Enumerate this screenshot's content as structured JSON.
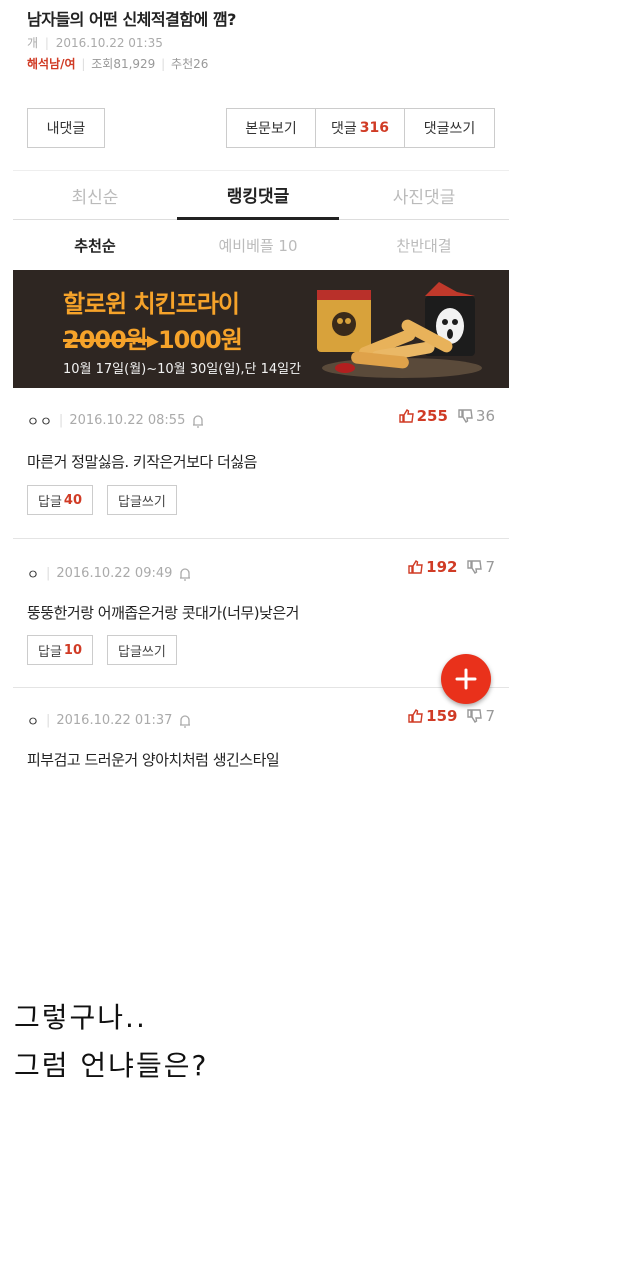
{
  "post": {
    "title": "남자들의 어떤 신체적결함에 깸?",
    "category": "개",
    "datetime": "2016.10.22 01:35",
    "author": "해석남/여",
    "views": "조회81,929",
    "recommends": "추천26"
  },
  "actions": {
    "my_comments": "내댓글",
    "view_post": "본문보기",
    "comments_label": "댓글",
    "comments_count": "316",
    "write_comment": "댓글쓰기"
  },
  "tabs": [
    {
      "label": "최신순"
    },
    {
      "label": "랭킹댓글"
    },
    {
      "label": "사진댓글"
    }
  ],
  "subtabs": [
    {
      "label": "추천순"
    },
    {
      "label": "예비베플 10"
    },
    {
      "label": "찬반대결"
    }
  ],
  "banner": {
    "title": "할로윈 치킨프라이",
    "old_price": "2000원",
    "new_price": "1000원",
    "period": "10월 17일(월)~10월 30일(일),단 14일간"
  },
  "comments": [
    {
      "user": "ㅇㅇ",
      "datetime": "2016.10.22 08:55",
      "up": "255",
      "down": "36",
      "text": "마른거 정말싫음. 키작은거보다 더싫음",
      "reply_label": "답글",
      "reply_count": "40",
      "write_reply": "답글쓰기"
    },
    {
      "user": "ㅇ",
      "datetime": "2016.10.22 09:49",
      "up": "192",
      "down": "7",
      "text": "뚱뚱한거랑 어깨좁은거랑 콧대가(너무)낮은거",
      "reply_label": "답글",
      "reply_count": "10",
      "write_reply": "답글쓰기"
    },
    {
      "user": "ㅇ",
      "datetime": "2016.10.22 01:37",
      "up": "159",
      "down": "7",
      "text": "피부검고 드러운거 양아치처럼 생긴스타일"
    }
  ],
  "caption": {
    "line1": "그렇구나..",
    "line2": "그럼 언냐들은?"
  },
  "colors": {
    "accent": "#d03b25",
    "fab": "#e9311b",
    "banner_bg": "#2e2622",
    "banner_text": "#f6a32a"
  }
}
